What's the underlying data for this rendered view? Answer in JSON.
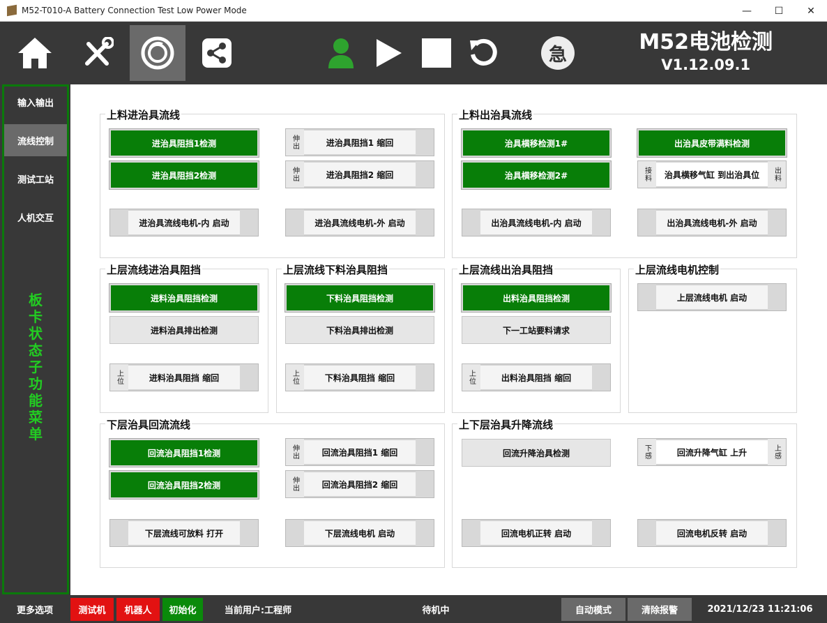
{
  "window": {
    "title": "M52-T010-A Battery Connection Test Low Power Mode",
    "min": "—",
    "max": "☐",
    "close": "✕"
  },
  "toolbar": {
    "brand_title": "M52电池检测",
    "version": "V1.12.09.1",
    "emergency": "急"
  },
  "sidebar": {
    "items": [
      {
        "label": "输入输出"
      },
      {
        "label": "流线控制",
        "active": true
      },
      {
        "label": "测试工站"
      },
      {
        "label": "人机交互"
      }
    ],
    "vertical_label": "板卡状态子功能菜单"
  },
  "groups": {
    "g1": {
      "title": "上料进治具流线",
      "b1": "进治具阻挡1检测",
      "b2": "进治具阻挡2检测",
      "t1": {
        "l": "伸出",
        "c": "进治具阻挡1 缩回"
      },
      "t2": {
        "l": "伸出",
        "c": "进治具阻挡2 缩回"
      },
      "m1": "进治具流线电机-内 启动",
      "m2": "进治具流线电机-外 启动"
    },
    "g2": {
      "title": "上料出治具流线",
      "b1": "治具横移检测1#",
      "b2": "治具横移检测2#",
      "b3": "出治具皮带满料检测",
      "t1": {
        "l": "接料",
        "c": "治具横移气缸 到出治具位",
        "r": "出料"
      },
      "m1": "出治具流线电机-内 启动",
      "m2": "出治具流线电机-外 启动"
    },
    "g3": {
      "title": "上层流线进治具阻挡",
      "b1": "进料治具阻挡检测",
      "b2": "进料治具排出检测",
      "t1": {
        "l": "上位",
        "c": "进料治具阻挡 缩回"
      }
    },
    "g4": {
      "title": "上层流线下料治具阻挡",
      "b1": "下料治具阻挡检测",
      "b2": "下料治具排出检测",
      "t1": {
        "l": "上位",
        "c": "下料治具阻挡 缩回"
      }
    },
    "g5": {
      "title": "上层流线出治具阻挡",
      "b1": "出料治具阻挡检测",
      "b2": "下一工站要料请求",
      "t1": {
        "l": "上位",
        "c": "出料治具阻挡 缩回"
      }
    },
    "g6": {
      "title": "上层流线电机控制",
      "m1": "上层流线电机 启动"
    },
    "g7": {
      "title": "下层治具回流流线",
      "b1": "回流治具阻挡1检测",
      "b2": "回流治具阻挡2检测",
      "t1": {
        "l": "伸出",
        "c": "回流治具阻挡1 缩回"
      },
      "t2": {
        "l": "伸出",
        "c": "回流治具阻挡2 缩回"
      },
      "m1": "下层流线可放料 打开",
      "m2": "下层流线电机 启动"
    },
    "g8": {
      "title": "上下层治具升降流线",
      "b1": "回流升降治具检测",
      "t1": {
        "l": "下感",
        "c": "回流升降气缸 上升",
        "r": "上感"
      },
      "m1": "回流电机正转 启动",
      "m2": "回流电机反转 启动"
    }
  },
  "statusbar": {
    "more": "更多选项",
    "tester": "测试机",
    "robot": "机器人",
    "init": "初始化",
    "user": "当前用户:工程师",
    "state": "待机中",
    "auto": "自动模式",
    "clear_alarm": "清除报警",
    "datetime": "2021/12/23 11:21:06"
  },
  "colors": {
    "green": "#087e08",
    "dark": "#383838",
    "red": "#e21212",
    "person": "#2ea32e"
  }
}
